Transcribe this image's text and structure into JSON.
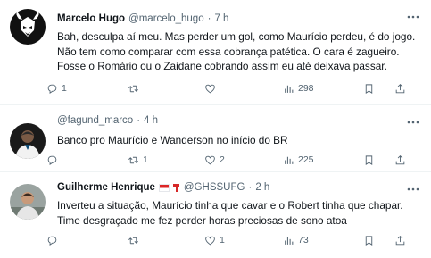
{
  "tweets": [
    {
      "name": "Marcelo Hugo",
      "handle": "@marcelo_hugo",
      "dot": "·",
      "time": "7 h",
      "lines": [
        "Bah, desculpa aí meu. Mas perder um gol, como Maurício perdeu, é do jogo.",
        "Não tem como comparar com essa cobrança patética. O cara é zagueiro.",
        "Fosse o Romário ou o Zaidane cobrando assim eu até deixava passar."
      ],
      "replies": "1",
      "retweets": "",
      "likes": "",
      "views": "298"
    },
    {
      "name": "",
      "handle": "@fagund_marco",
      "dot": "·",
      "time": "4 h",
      "lines": [
        "Banco pro Maurício e Wanderson no início do BR"
      ],
      "replies": "",
      "retweets": "1",
      "likes": "2",
      "views": "225"
    },
    {
      "name": "Guilherme Henrique",
      "handle": "@GHSSUFG",
      "dot": "·",
      "time": "2 h",
      "lines": [
        "Inverteu a situação, Maurício tinha que cavar e o Robert tinha que chapar.",
        "Time desgraçado me fez perder horas preciosas de sono atoa"
      ],
      "replies": "",
      "retweets": "",
      "likes": "1",
      "views": "73"
    }
  ],
  "icons": {
    "reply": "reply-icon",
    "retweet": "retweet-icon",
    "like": "heart-icon",
    "views": "views-chart-icon",
    "bookmark": "bookmark-icon",
    "share": "share-icon",
    "more": "more-dots-icon"
  },
  "colors": {
    "text": "#0f1419",
    "muted": "#536471",
    "divider": "#eff3f4"
  }
}
